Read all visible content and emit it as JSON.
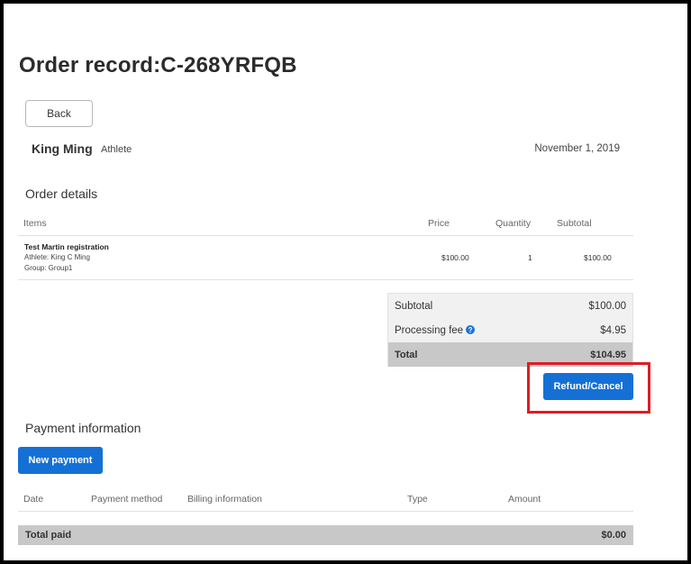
{
  "page": {
    "title": "Order record:C-268YRFQB",
    "back_label": "Back"
  },
  "customer": {
    "name": "King Ming",
    "role": "Athlete",
    "date": "November 1, 2019"
  },
  "order_details": {
    "title": "Order details",
    "columns": {
      "items": "Items",
      "price": "Price",
      "quantity": "Quantity",
      "subtotal": "Subtotal"
    },
    "rows": [
      {
        "name": "Test Martin registration",
        "athlete": "Athlete: King C Ming",
        "group": "Group: Group1",
        "price": "$100.00",
        "quantity": "1",
        "subtotal": "$100.00"
      }
    ]
  },
  "summary": {
    "subtotal_label": "Subtotal",
    "subtotal_value": "$100.00",
    "fee_label": "Processing fee",
    "fee_help_icon": "?",
    "fee_value": "$4.95",
    "total_label": "Total",
    "total_value": "$104.95"
  },
  "actions": {
    "refund_label": "Refund/Cancel",
    "highlight_color": "#e01c24"
  },
  "payment": {
    "title": "Payment information",
    "new_payment_label": "New payment",
    "columns": {
      "date": "Date",
      "method": "Payment method",
      "billing": "Billing information",
      "type": "Type",
      "amount": "Amount"
    },
    "total_paid_label": "Total paid",
    "total_paid_value": "$0.00"
  },
  "colors": {
    "primary_button": "#1570d6",
    "total_bar": "#c8c8c8"
  }
}
